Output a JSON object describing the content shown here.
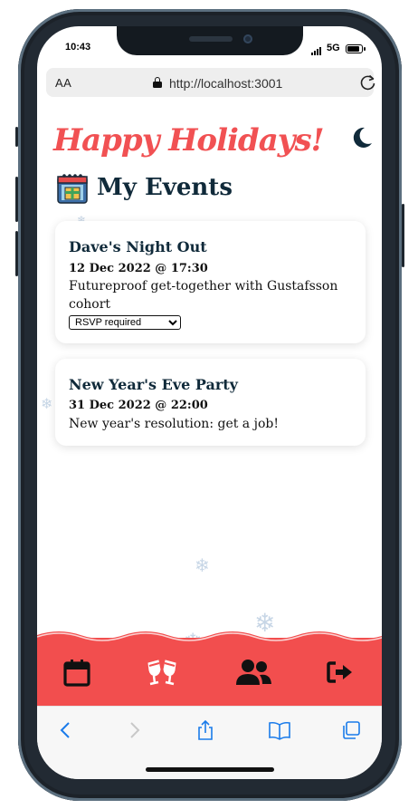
{
  "status": {
    "time": "10:43",
    "network": "5G"
  },
  "browser": {
    "text_size": "AA",
    "url": "http://localhost:3001"
  },
  "header": {
    "title": "Happy Holidays!",
    "events_heading": "My Events"
  },
  "events": [
    {
      "title": "Dave's Night Out",
      "date": "12 Dec 2022 @ 17:30",
      "description": "Futureproof get-together with Gustafsson cohort",
      "rsvp": {
        "selected": "RSVP required"
      }
    },
    {
      "title": "New Year's Eve Party",
      "date": "31 Dec 2022 @ 22:00",
      "description": "New year's resolution: get a job!"
    }
  ],
  "colors": {
    "accent": "#f15153",
    "nav_bg": "#f24e4e",
    "heading": "#102a3a"
  },
  "nav_icons": [
    "calendar-icon",
    "cheers-icon",
    "users-icon",
    "logout-icon"
  ],
  "safari_toolbar_icons": [
    "back-icon",
    "forward-icon",
    "share-icon",
    "bookmarks-icon",
    "tabs-icon"
  ]
}
